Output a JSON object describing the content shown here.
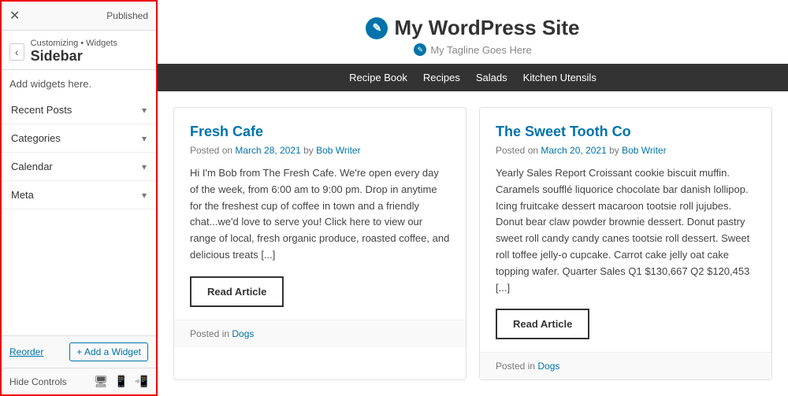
{
  "topbar": {
    "close_label": "✕",
    "published_label": "Published"
  },
  "breadcrumb": {
    "back_label": "‹",
    "path": "Customizing • Widgets",
    "section": "Sidebar"
  },
  "sidebar": {
    "add_widgets_label": "Add widgets here.",
    "widgets": [
      {
        "name": "Recent Posts"
      },
      {
        "name": "Categories"
      },
      {
        "name": "Calendar"
      },
      {
        "name": "Meta"
      }
    ],
    "reorder_label": "Reorder",
    "add_widget_label": "+ Add a Widget"
  },
  "bottom_controls": {
    "hide_label": "Hide Controls",
    "icons": [
      "desktop",
      "tablet",
      "mobile"
    ]
  },
  "wp_site": {
    "title": "My WordPress Site",
    "tagline": "My Tagline Goes Here",
    "nav": [
      {
        "label": "Recipe Book"
      },
      {
        "label": "Recipes"
      },
      {
        "label": "Salads"
      },
      {
        "label": "Kitchen Utensils"
      }
    ],
    "posts": [
      {
        "title": "Fresh Cafe",
        "date": "March 28, 2021",
        "author": "Bob Writer",
        "excerpt": "Hi I'm Bob from The Fresh Cafe. We're open every day of the week, from 6:00 am to 9:00 pm. Drop in anytime for the freshest cup of coffee in town and a friendly chat...we'd love to serve you! Click here to view our range of local, fresh organic produce, roasted coffee, and delicious treats [...]",
        "read_label": "Read Article",
        "posted_in": "Dogs"
      },
      {
        "title": "The Sweet Tooth Co",
        "date": "March 20, 2021",
        "author": "Bob Writer",
        "excerpt": "Yearly Sales Report Croissant cookie biscuit muffin. Caramels soufflé liquorice chocolate bar danish lollipop. Icing fruitcake dessert macaroon tootsie roll jujubes. Donut bear claw powder brownie dessert. Donut pastry sweet roll candy candy canes tootsie roll dessert. Sweet roll toffee jelly-o cupcake. Carrot cake jelly oat cake topping wafer. Quarter Sales Q1 $130,667 Q2 $120,453 [...]",
        "read_label": "Read Article",
        "posted_in": "Dogs"
      }
    ]
  }
}
